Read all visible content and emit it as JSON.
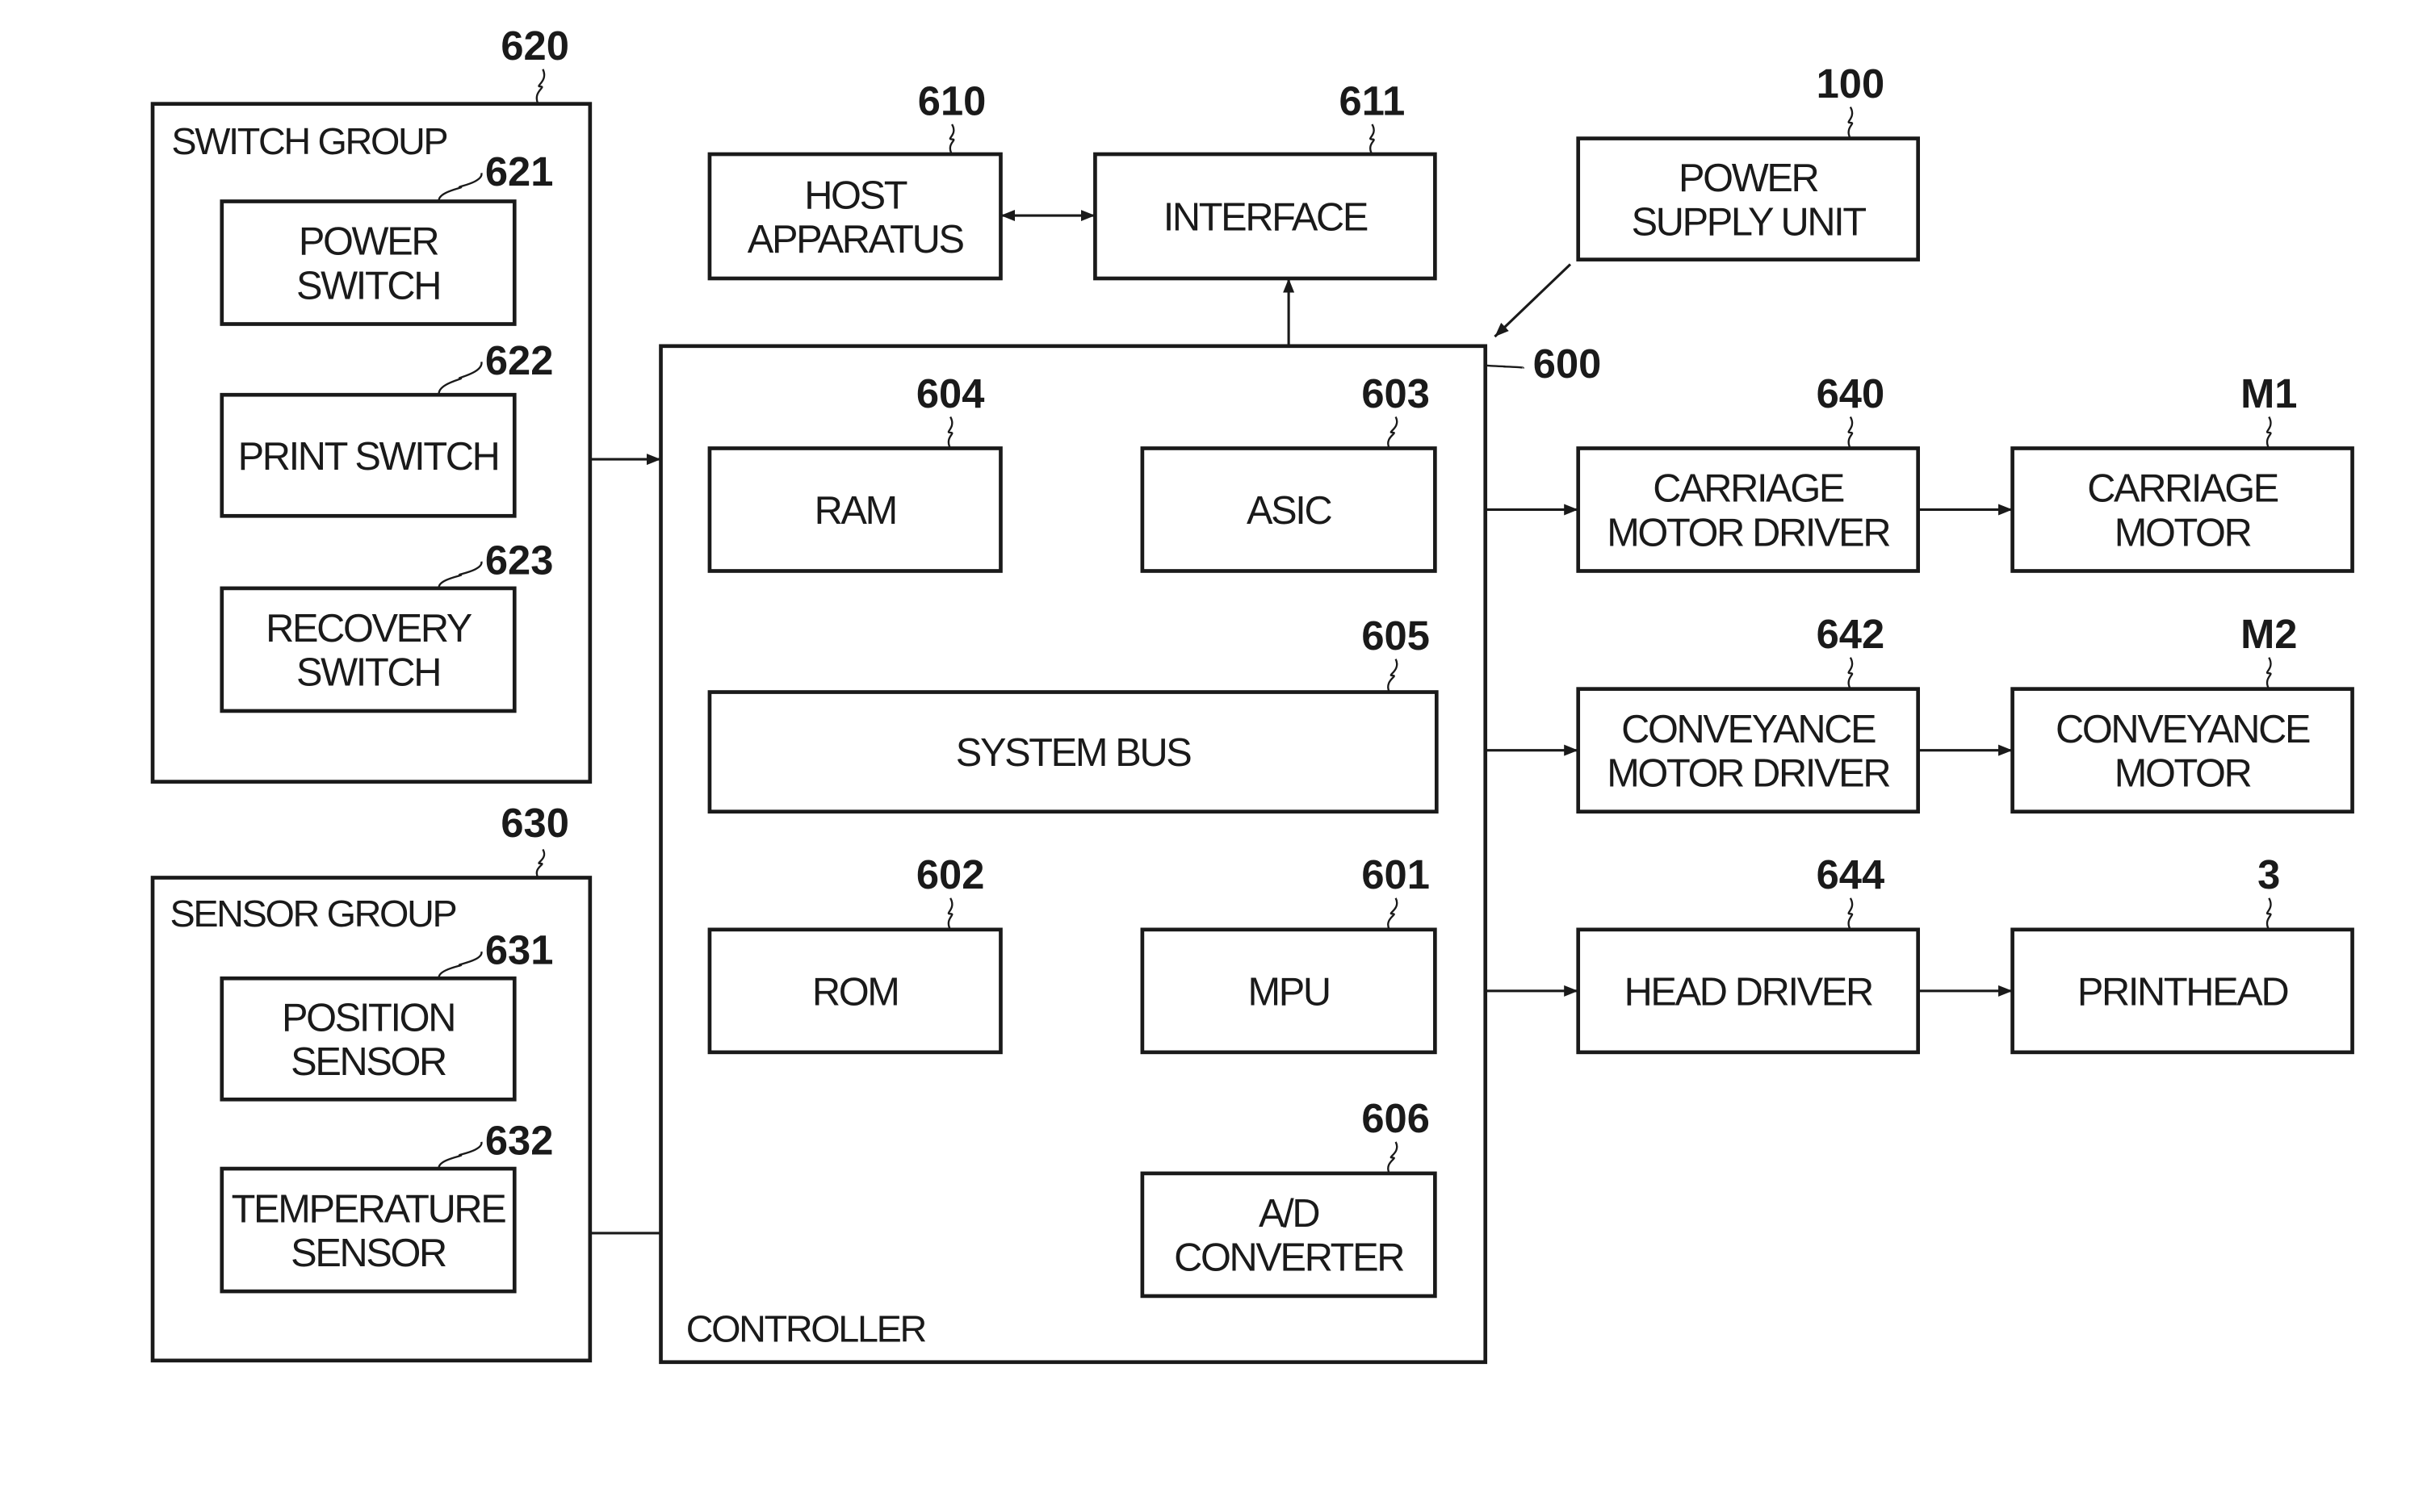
{
  "diagram": {
    "groups": {
      "switch_group": {
        "ref": "620",
        "title": "SWITCH GROUP"
      },
      "sensor_group": {
        "ref": "630",
        "title": "SENSOR GROUP"
      },
      "controller": {
        "ref": "600",
        "title": "CONTROLLER"
      }
    },
    "blocks": {
      "power_switch": {
        "ref": "621",
        "lines": [
          "POWER",
          "SWITCH"
        ]
      },
      "print_switch": {
        "ref": "622",
        "lines": [
          "PRINT SWITCH"
        ]
      },
      "recovery_switch": {
        "ref": "623",
        "lines": [
          "RECOVERY",
          "SWITCH"
        ]
      },
      "position_sensor": {
        "ref": "631",
        "lines": [
          "POSITION",
          "SENSOR"
        ]
      },
      "temperature_sensor": {
        "ref": "632",
        "lines": [
          "TEMPERATURE",
          "SENSOR"
        ]
      },
      "host_apparatus": {
        "ref": "610",
        "lines": [
          "HOST",
          "APPARATUS"
        ]
      },
      "interface": {
        "ref": "611",
        "lines": [
          "INTERFACE"
        ]
      },
      "power_supply_unit": {
        "ref": "100",
        "lines": [
          "POWER",
          "SUPPLY UNIT"
        ]
      },
      "ram": {
        "ref": "604",
        "lines": [
          "RAM"
        ]
      },
      "asic": {
        "ref": "603",
        "lines": [
          "ASIC"
        ]
      },
      "system_bus": {
        "ref": "605",
        "lines": [
          "SYSTEM BUS"
        ]
      },
      "rom": {
        "ref": "602",
        "lines": [
          "ROM"
        ]
      },
      "mpu": {
        "ref": "601",
        "lines": [
          "MPU"
        ]
      },
      "ad_converter": {
        "ref": "606",
        "lines": [
          "A/D",
          "CONVERTER"
        ]
      },
      "carriage_motor_driver": {
        "ref": "640",
        "lines": [
          "CARRIAGE",
          "MOTOR DRIVER"
        ]
      },
      "conveyance_motor_driver": {
        "ref": "642",
        "lines": [
          "CONVEYANCE",
          "MOTOR DRIVER"
        ]
      },
      "head_driver": {
        "ref": "644",
        "lines": [
          "HEAD DRIVER"
        ]
      },
      "carriage_motor": {
        "ref": "M1",
        "lines": [
          "CARRIAGE",
          "MOTOR"
        ]
      },
      "conveyance_motor": {
        "ref": "M2",
        "lines": [
          "CONVEYANCE",
          "MOTOR"
        ]
      },
      "printhead": {
        "ref": "3",
        "lines": [
          "PRINTHEAD"
        ]
      }
    },
    "connections": [
      {
        "from": "host_apparatus",
        "to": "interface",
        "type": "bidirectional"
      },
      {
        "from": "interface",
        "to": "asic",
        "type": "bidirectional"
      },
      {
        "from": "ram",
        "to": "system_bus",
        "type": "bidirectional"
      },
      {
        "from": "asic",
        "to": "system_bus",
        "type": "bidirectional"
      },
      {
        "from": "system_bus",
        "to": "mpu",
        "type": "bidirectional"
      },
      {
        "from": "rom",
        "to": "mpu",
        "type": "unidirectional"
      },
      {
        "from": "ad_converter",
        "to": "mpu",
        "type": "unidirectional"
      },
      {
        "from": "switch_group",
        "to": "controller",
        "type": "unidirectional"
      },
      {
        "from": "temperature_sensor",
        "to": "ad_converter",
        "type": "unidirectional"
      },
      {
        "from": "power_supply_unit",
        "to": "controller",
        "type": "unidirectional"
      },
      {
        "from": "controller",
        "to": "carriage_motor_driver",
        "type": "unidirectional"
      },
      {
        "from": "controller",
        "to": "conveyance_motor_driver",
        "type": "unidirectional"
      },
      {
        "from": "controller",
        "to": "head_driver",
        "type": "unidirectional"
      },
      {
        "from": "carriage_motor_driver",
        "to": "carriage_motor",
        "type": "unidirectional"
      },
      {
        "from": "conveyance_motor_driver",
        "to": "conveyance_motor",
        "type": "unidirectional"
      },
      {
        "from": "head_driver",
        "to": "printhead",
        "type": "unidirectional"
      }
    ]
  }
}
